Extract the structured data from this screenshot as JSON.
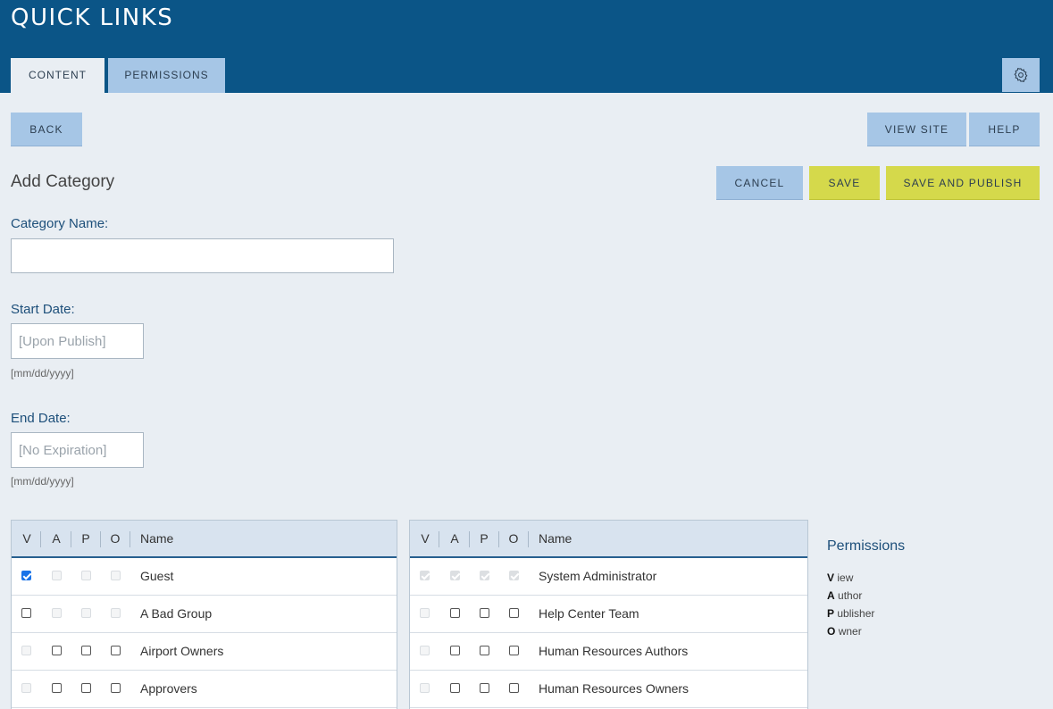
{
  "header": {
    "title": "QUICK LINKS",
    "tabs": [
      {
        "label": "CONTENT",
        "active": true
      },
      {
        "label": "PERMISSIONS",
        "active": false
      }
    ],
    "settings_icon": "gear-icon"
  },
  "toolbar": {
    "back_label": "BACK",
    "view_site_label": "VIEW SITE",
    "help_label": "HELP"
  },
  "form": {
    "heading": "Add Category",
    "cancel_label": "CANCEL",
    "save_label": "SAVE",
    "save_publish_label": "SAVE AND PUBLISH",
    "category_name": {
      "label": "Category Name:",
      "value": "",
      "placeholder": ""
    },
    "start_date": {
      "label": "Start Date:",
      "value": "",
      "placeholder": "[Upon Publish]",
      "hint": "[mm/dd/yyyy]"
    },
    "end_date": {
      "label": "End Date:",
      "value": "",
      "placeholder": "[No Expiration]",
      "hint": "[mm/dd/yyyy]"
    }
  },
  "permissions_table": {
    "columns": [
      "V",
      "A",
      "P",
      "O",
      "Name"
    ],
    "left_rows": [
      {
        "name": "Guest",
        "v": "checked",
        "a": "disabled",
        "p": "disabled",
        "o": "disabled"
      },
      {
        "name": "A Bad Group",
        "v": "unchecked",
        "a": "disabled",
        "p": "disabled",
        "o": "disabled"
      },
      {
        "name": "Airport Owners",
        "v": "disabled",
        "a": "unchecked",
        "p": "unchecked",
        "o": "unchecked"
      },
      {
        "name": "Approvers",
        "v": "disabled",
        "a": "unchecked",
        "p": "unchecked",
        "o": "unchecked"
      }
    ],
    "right_rows": [
      {
        "name": "System Administrator",
        "v": "checked-disabled",
        "a": "checked-disabled",
        "p": "checked-disabled",
        "o": "checked-disabled"
      },
      {
        "name": "Help Center Team",
        "v": "disabled",
        "a": "unchecked",
        "p": "unchecked",
        "o": "unchecked"
      },
      {
        "name": "Human Resources Authors",
        "v": "disabled",
        "a": "unchecked",
        "p": "unchecked",
        "o": "unchecked"
      },
      {
        "name": "Human Resources Owners",
        "v": "disabled",
        "a": "unchecked",
        "p": "unchecked",
        "o": "unchecked"
      }
    ]
  },
  "legend": {
    "title": "Permissions",
    "items": [
      {
        "key": "V",
        "rest": "iew"
      },
      {
        "key": "A",
        "rest": "uthor"
      },
      {
        "key": "P",
        "rest": "ublisher"
      },
      {
        "key": "O",
        "rest": "wner"
      }
    ]
  },
  "colors": {
    "header_bg": "#0b5587",
    "tab_inactive": "#a6c6e6",
    "button_blue": "#a6c6e6",
    "button_yellow": "#d5d94b",
    "page_bg": "#e9eef3",
    "label_blue": "#1d4f7a"
  }
}
